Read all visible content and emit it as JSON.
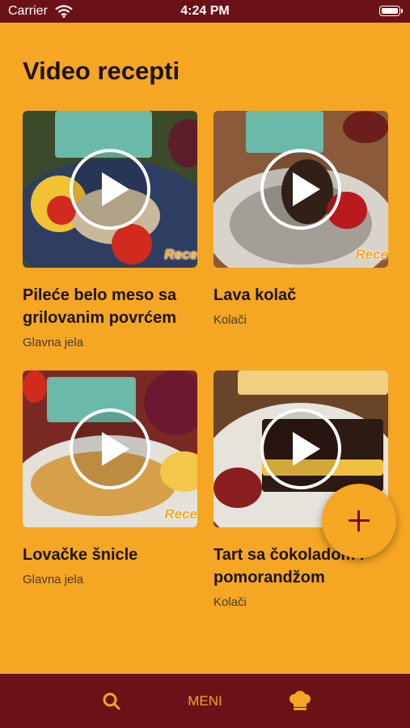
{
  "status_bar": {
    "carrier": "Carrier",
    "time": "4:24 PM"
  },
  "page": {
    "title": "Video recepti"
  },
  "recipes": [
    {
      "title": "Pileće belo meso sa grilovanim povrćem",
      "category": "Glavna jela",
      "watermark": "Rece"
    },
    {
      "title": "Lava kolač",
      "category": "Kolači",
      "watermark": "Rece"
    },
    {
      "title": "Lovačke šnicle",
      "category": "Glavna jela",
      "watermark": "Rece"
    },
    {
      "title": "Tart sa čokoladom i pomorandžom",
      "category": "Kolači",
      "watermark": ""
    }
  ],
  "fab": {
    "icon": "plus-icon"
  },
  "bottom_nav": {
    "search_icon": "search-icon",
    "menu_label": "MENI",
    "profile_icon": "chef-hat-icon"
  },
  "colors": {
    "background": "#F5A623",
    "bars": "#6B1218",
    "text": "#1b1410"
  }
}
